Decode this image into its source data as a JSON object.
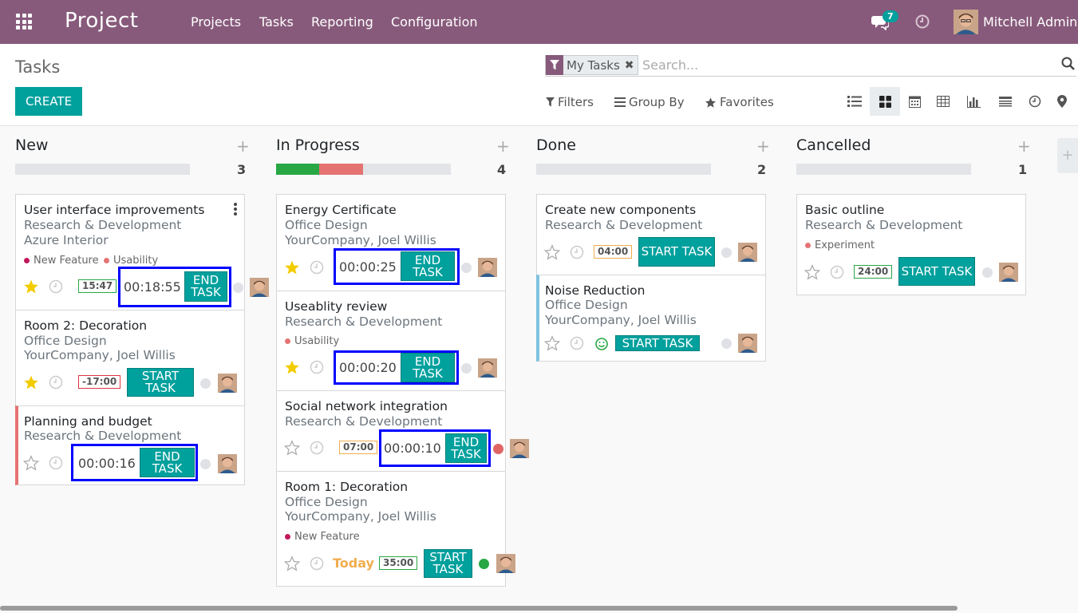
{
  "navbar": {
    "brand": "Project",
    "menu": [
      "Projects",
      "Tasks",
      "Reporting",
      "Configuration"
    ],
    "messages_count": "7",
    "user_name": "Mitchell Admin"
  },
  "control": {
    "breadcrumb": "Tasks",
    "create_label": "CREATE",
    "facet_value": "My Tasks",
    "search_placeholder": "Search...",
    "filters_label": "Filters",
    "groupby_label": "Group By",
    "favorites_label": "Favorites"
  },
  "columns": [
    {
      "title": "New",
      "count": "3"
    },
    {
      "title": "In Progress",
      "count": "4"
    },
    {
      "title": "Done",
      "count": "2"
    },
    {
      "title": "Cancelled",
      "count": "1"
    }
  ],
  "cards": {
    "c1": {
      "name": "User interface improvements",
      "project": "Research & Development",
      "customer": "Azure Interior",
      "tag1": "New Feature",
      "tag2": "Usability",
      "planned": "15:47",
      "timer": "00:18:55",
      "button": "END TASK"
    },
    "c2": {
      "name": "Room 2: Decoration",
      "project": "Office Design",
      "customer": "YourCompany, Joel Willis",
      "planned": "-17:00",
      "button": "START TASK"
    },
    "c3": {
      "name": "Planning and budget",
      "project": "Research & Development",
      "timer": "00:00:16",
      "button": "END TASK"
    },
    "c4": {
      "name": "Energy Certificate",
      "project": "Office Design",
      "customer": "YourCompany, Joel Willis",
      "timer": "00:00:25",
      "button": "END TASK"
    },
    "c5": {
      "name": "Useablity review",
      "project": "Research & Development",
      "tag1": "Usability",
      "timer": "00:00:20",
      "button": "END TASK"
    },
    "c6": {
      "name": "Social network integration",
      "project": "Research & Development",
      "planned": "07:00",
      "timer": "00:00:10",
      "button": "END TASK"
    },
    "c7": {
      "name": "Room 1: Decoration",
      "project": "Office Design",
      "customer": "YourCompany, Joel Willis",
      "tag1": "New Feature",
      "deadline": "Today",
      "planned": "35:00",
      "button": "START TASK"
    },
    "c8": {
      "name": "Create new components",
      "project": "Research & Development",
      "planned": "04:00",
      "button": "START TASK"
    },
    "c9": {
      "name": "Noise Reduction",
      "project": "Office Design",
      "customer": "YourCompany, Joel Willis",
      "button": "START TASK"
    },
    "c10": {
      "name": "Basic outline",
      "project": "Research & Development",
      "tag1": "Experiment",
      "planned": "24:00",
      "button": "START TASK"
    }
  },
  "colors": {
    "brand": "#875a7b",
    "primary": "#00a09d",
    "highlight_frame": "#0000ff",
    "star": "#f3cc00",
    "tag_new_feature": "#c2185b",
    "tag_usability": "#e57373",
    "tag_experiment": "#e57373"
  }
}
